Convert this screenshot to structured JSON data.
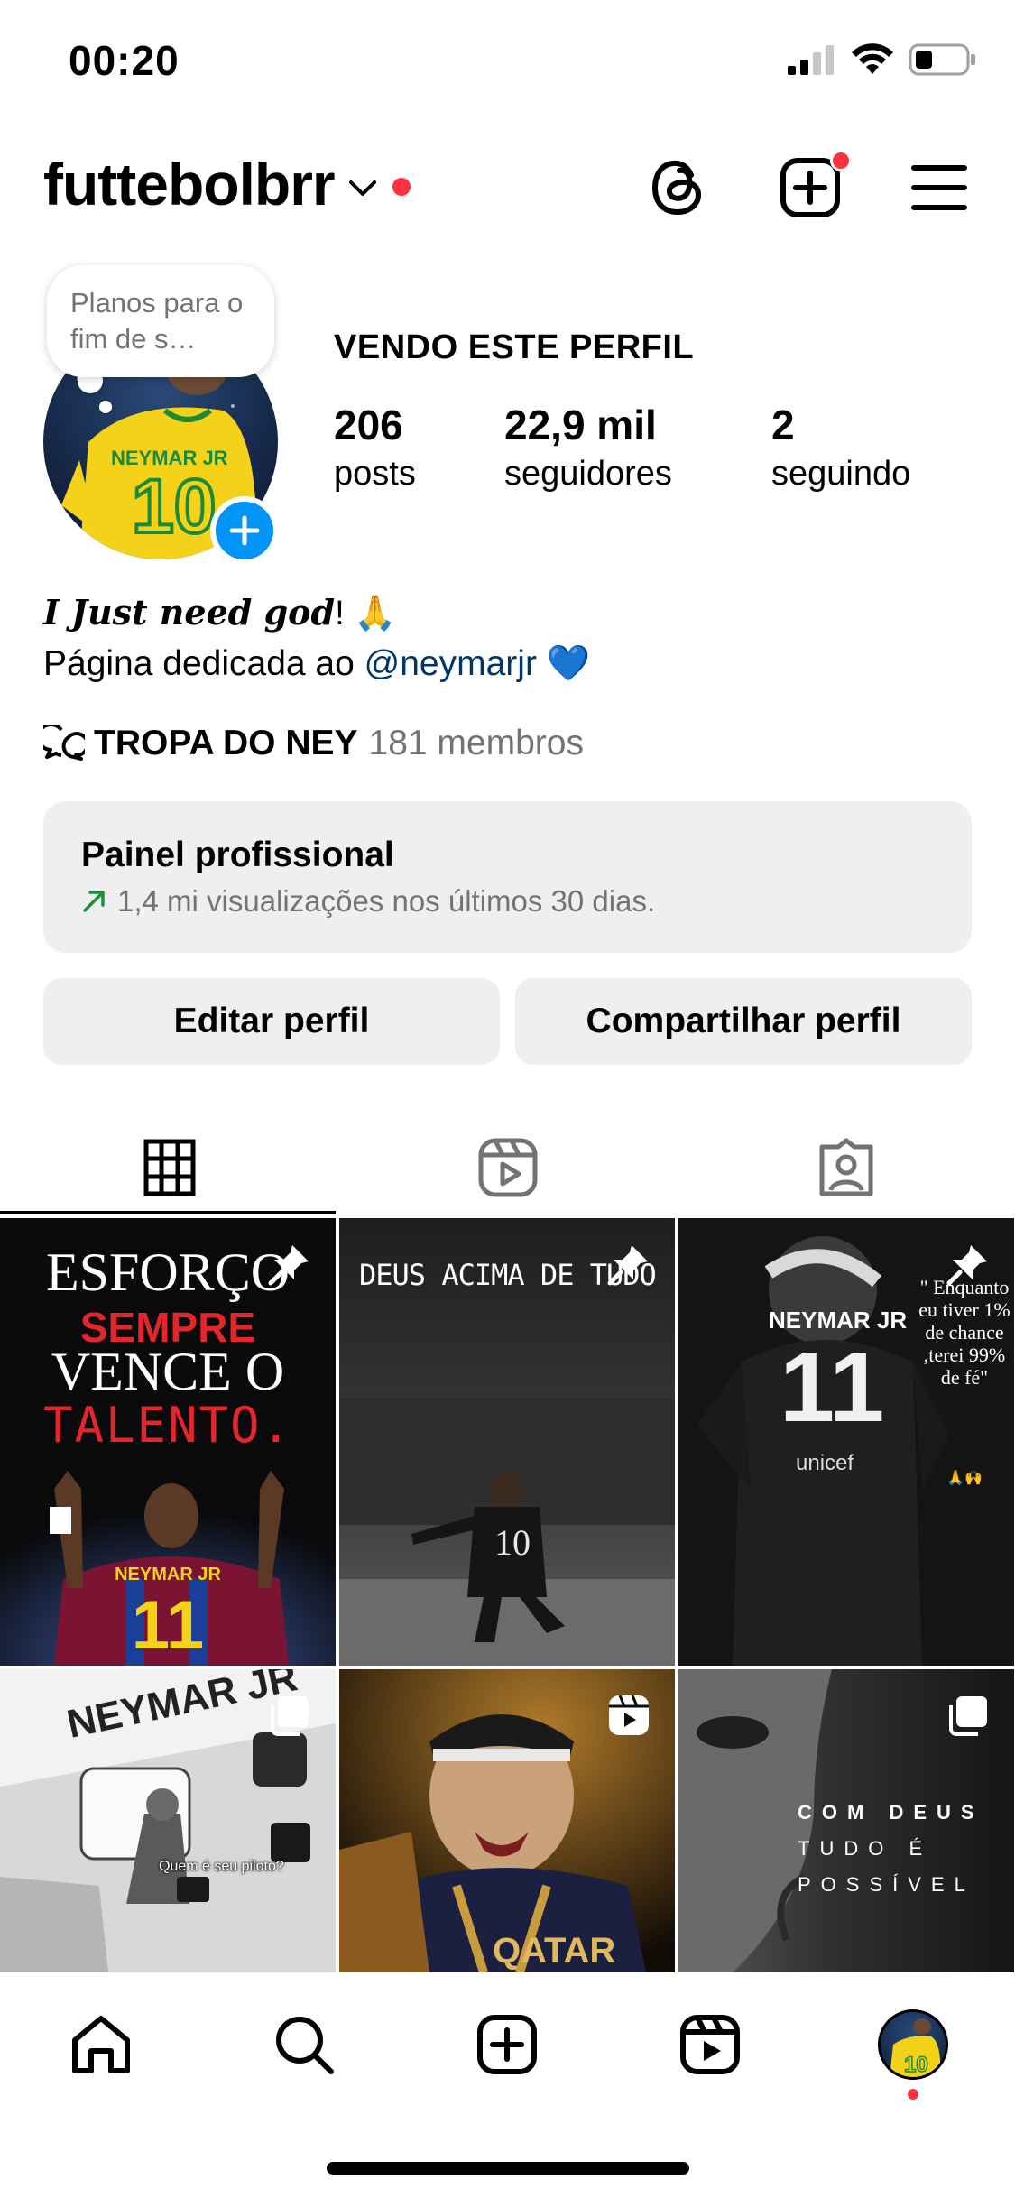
{
  "status_bar": {
    "time": "00:20"
  },
  "header": {
    "username": "futtebolbrr"
  },
  "profile": {
    "note": "Planos para o fim de s…",
    "watching_label": "VENDO ESTE PERFIL",
    "stats": [
      {
        "value": "206",
        "label": "posts"
      },
      {
        "value": "22,9 mil",
        "label": "seguidores"
      },
      {
        "value": "2",
        "label": "seguindo"
      }
    ],
    "bio_line1": "I Just need god",
    "bio_line1_suffix": "! 🙏",
    "bio_line2_prefix": "Página dedicada ao ",
    "bio_mention": "@neymarjr",
    "bio_line2_suffix": " 💙",
    "channel_name": "TROPA DO NEY",
    "channel_members": "181 membros"
  },
  "dashboard": {
    "title": "Painel profissional",
    "subtitle": "1,4 mi visualizações nos últimos 30 dias."
  },
  "buttons": {
    "edit": "Editar perfil",
    "share": "Compartilhar perfil"
  },
  "posts": {
    "p1": {
      "line1": "ESFORÇO",
      "line2": "SEMPRE",
      "line3": "VENCE O",
      "line4": "TALENTO.",
      "jersey": "NEYMAR JR",
      "number": "11"
    },
    "p2": {
      "caption": "DEUS ACIMA DE TUDO",
      "number": "10"
    },
    "p3": {
      "quote": "\" Enquanto eu tiver 1% de chance ,terei 99% de fé\"",
      "emoji": "🙏🙌",
      "jersey": "NEYMAR JR",
      "number": "11",
      "sponsor": "unicef"
    },
    "p4": {
      "banner": "NEYMAR JR",
      "sticker": "Quem é seu piloto?"
    },
    "p5": {
      "banner": "QATAR"
    },
    "p6": {
      "line1": "COM DEUS",
      "line2": "TUDO É",
      "line3": "POSSÍVEL"
    }
  },
  "icons": {
    "colors": {
      "notification": "#ff3040",
      "accent": "#0095f6",
      "mention": "#00376b",
      "muted": "#737373",
      "surface": "#efefef"
    }
  }
}
